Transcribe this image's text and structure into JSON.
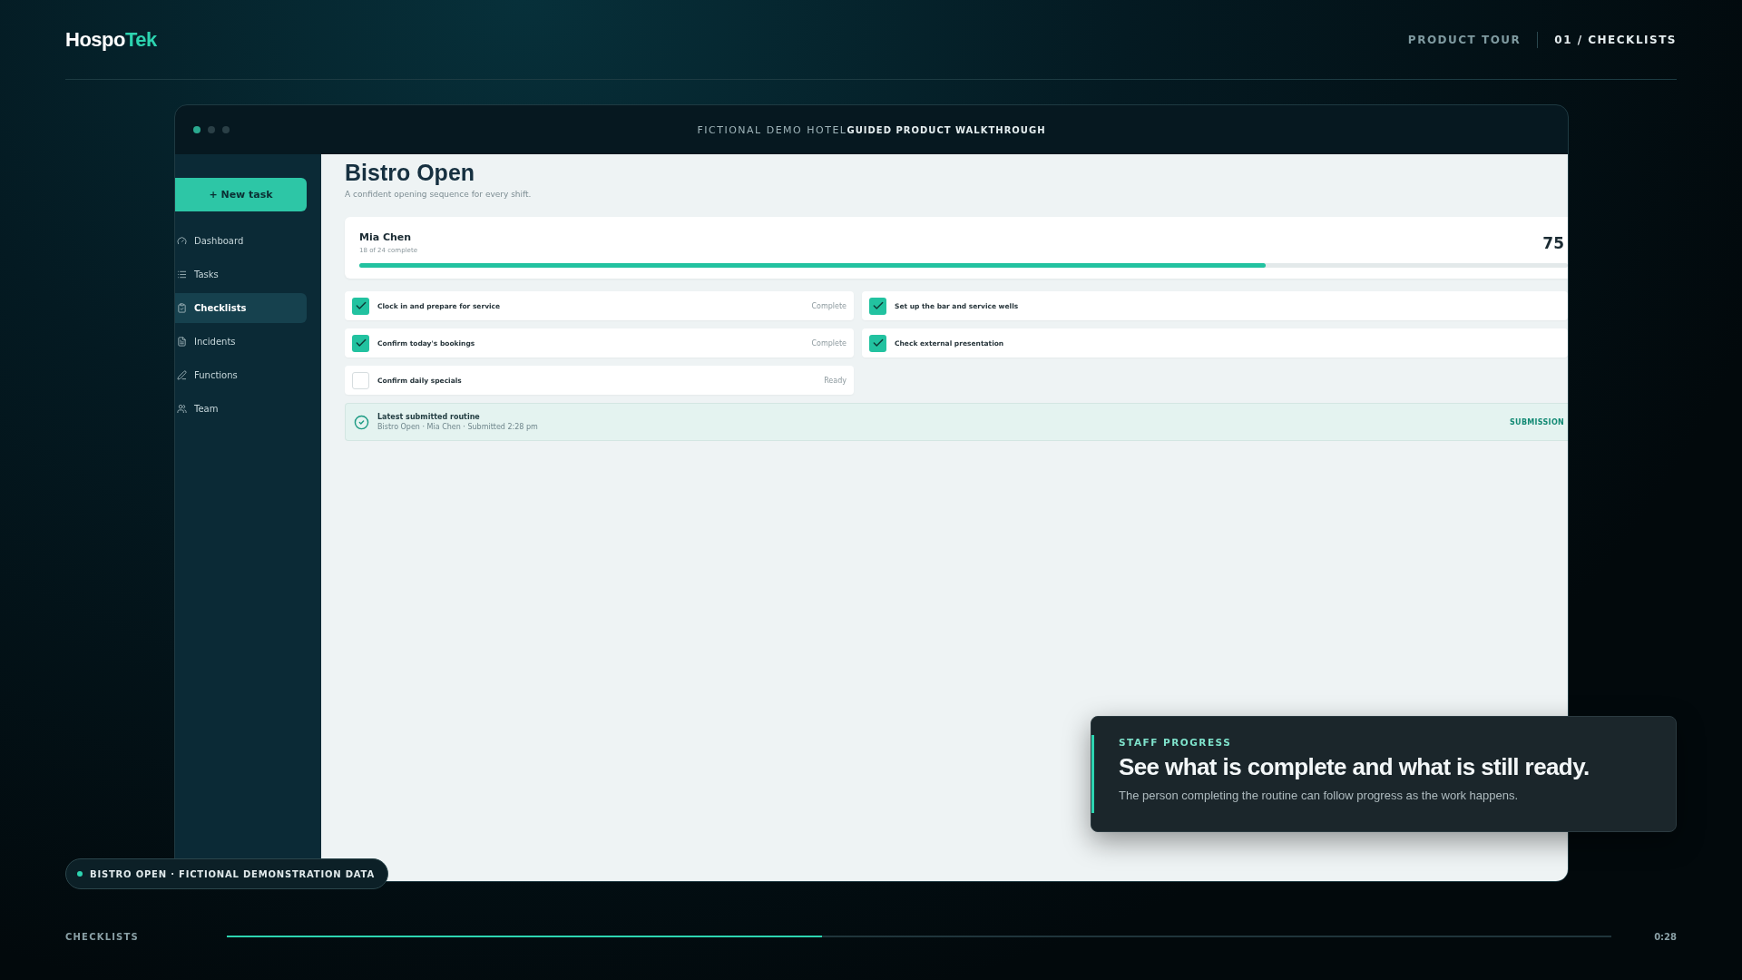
{
  "header": {
    "logo": {
      "part1": "Hospo",
      "part2": "Tek"
    },
    "nav": [
      {
        "label": "PRODUCT TOUR",
        "selected": false
      },
      {
        "label": "01 / CHECKLISTS",
        "selected": true
      }
    ]
  },
  "window": {
    "title": "FICTIONAL DEMO HOTEL",
    "subtitle": "GUIDED PRODUCT WALKTHROUGH"
  },
  "sidebar": {
    "new_button": "+ New task",
    "items": [
      {
        "label": "Dashboard",
        "selected": false
      },
      {
        "label": "Tasks",
        "selected": false
      },
      {
        "label": "Checklists",
        "selected": true
      },
      {
        "label": "Incidents",
        "selected": false
      },
      {
        "label": "Functions",
        "selected": false
      },
      {
        "label": "Team",
        "selected": false
      }
    ]
  },
  "page": {
    "title": "Bistro Open",
    "subtitle": "A confident opening sequence for every shift."
  },
  "progress_card": {
    "name": "Mia Chen",
    "detail": "18 of 24 complete",
    "percent": "75",
    "level": 0.75
  },
  "tasks": [
    {
      "label": "Clock in and prepare for service",
      "checked": true,
      "status": "Complete"
    },
    {
      "label": "Set up the bar and service wells",
      "checked": true
    },
    {
      "label": "Confirm today's bookings",
      "checked": true,
      "status": "Complete"
    },
    {
      "label": "Check external presentation",
      "checked": true
    },
    {
      "label": "Confirm daily specials",
      "checked": false,
      "status": "Ready"
    }
  ],
  "latest": {
    "title": "Latest submitted routine",
    "meta": "Bistro Open · Mia Chen · Submitted 2:28 pm",
    "link": "SUBMISSION"
  },
  "caption": {
    "eyebrow": "STAFF PROGRESS",
    "heading": "See what is complete and what is still ready.",
    "body": "The person completing the routine can follow progress as the work happens."
  },
  "badge": {
    "label": "BISTRO OPEN · FICTIONAL DEMONSTRATION DATA"
  },
  "timeline": {
    "label": "CHECKLISTS",
    "level": 0.43,
    "time": "0:28"
  }
}
